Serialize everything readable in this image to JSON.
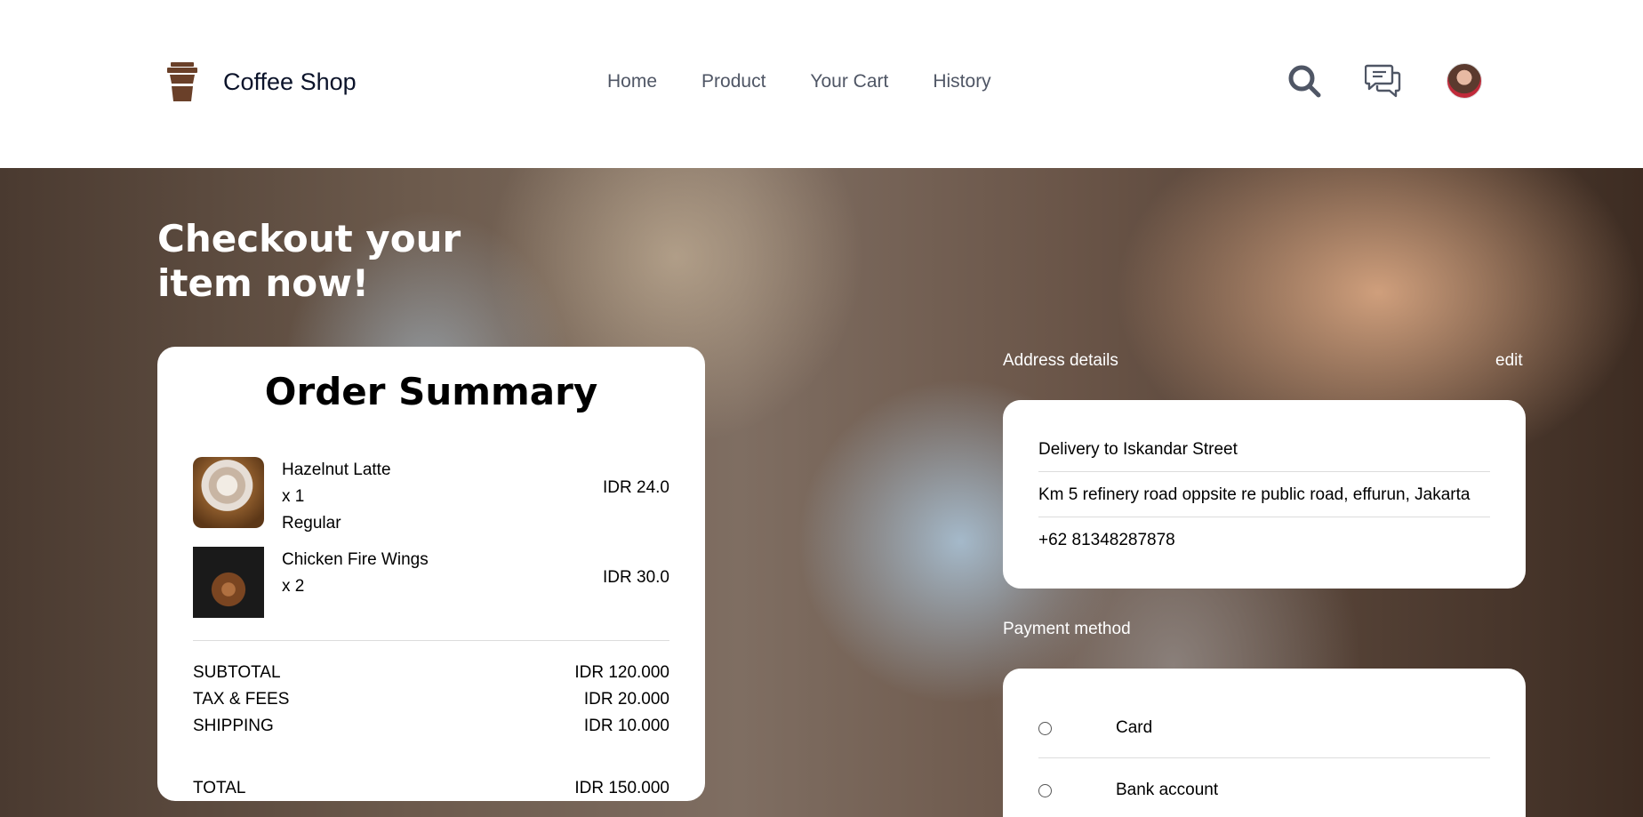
{
  "header": {
    "brand_name": "Coffee Shop",
    "nav": [
      "Home",
      "Product",
      "Your Cart",
      "History"
    ]
  },
  "hero": {
    "title": "Checkout your item now!"
  },
  "order_summary": {
    "title": "Order Summary",
    "items": [
      {
        "name": "Hazelnut Latte",
        "qty": "x 1",
        "size": "Regular",
        "price": "IDR 24.0"
      },
      {
        "name": "Chicken Fire Wings",
        "qty": "x 2",
        "price": "IDR 30.0"
      }
    ],
    "subtotal_label": "SUBTOTAL",
    "subtotal_value": "IDR 120.000",
    "tax_label": "TAX & FEES",
    "tax_value": "IDR 20.000",
    "shipping_label": "SHIPPING",
    "shipping_value": "IDR 10.000",
    "total_label": "TOTAL",
    "total_value": "IDR 150.000"
  },
  "address": {
    "label": "Address details",
    "edit": "edit",
    "line1": "Delivery to Iskandar Street",
    "line2": "Km 5 refinery road oppsite re public road, effurun, Jakarta",
    "phone": "+62 81348287878"
  },
  "payment": {
    "label": "Payment method",
    "options": [
      "Card",
      "Bank account"
    ]
  },
  "colors": {
    "brand_brown": "#6a4029",
    "nav_text": "#4f5665",
    "icon_gray": "#4f5665"
  }
}
